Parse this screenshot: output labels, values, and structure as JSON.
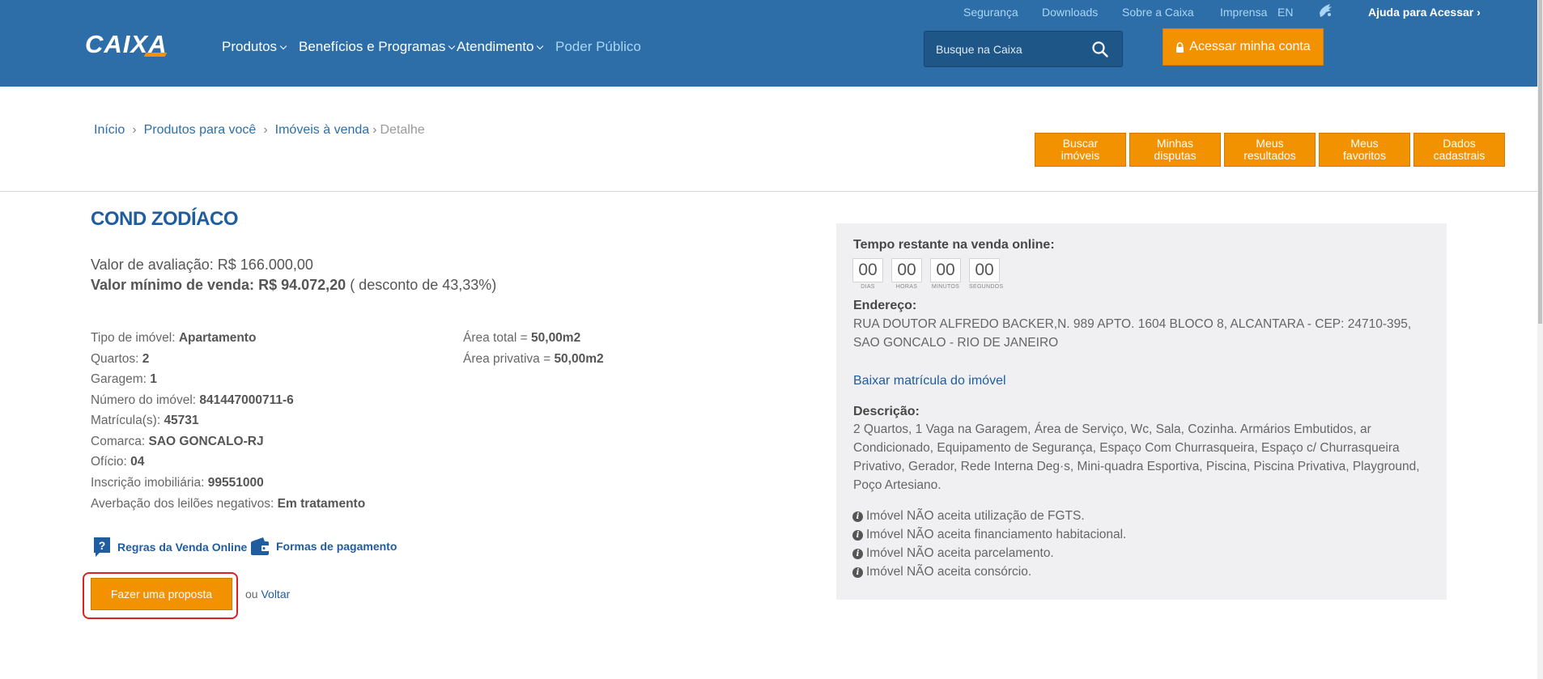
{
  "header": {
    "top_links": [
      "Segurança",
      "Downloads",
      "Sobre a Caixa",
      "Imprensa",
      "EN"
    ],
    "help_link": "Ajuda para Acessar ›",
    "logo_text": "CAIXA",
    "nav": [
      {
        "label": "Produtos",
        "dropdown": true
      },
      {
        "label": "Benefícios e Programas",
        "dropdown": true
      },
      {
        "label": "Atendimento",
        "dropdown": true
      },
      {
        "label": "Poder Público",
        "dropdown": false
      }
    ],
    "search_placeholder": "Busque na Caixa",
    "login_label": "Acessar minha conta"
  },
  "breadcrumb": {
    "items": [
      "Início",
      "Produtos para você",
      "Imóveis à venda"
    ],
    "current": "Detalhe",
    "separator": "›"
  },
  "actions": [
    {
      "line1": "Buscar",
      "line2": "imóveis"
    },
    {
      "line1": "Minhas",
      "line2": "disputas"
    },
    {
      "line1": "Meus",
      "line2": "resultados"
    },
    {
      "line1": "Meus",
      "line2": "favoritos"
    },
    {
      "line1": "Dados",
      "line2": "cadastrais"
    }
  ],
  "property": {
    "title": "COND ZODÍACO",
    "valor_avaliacao_label": "Valor de avaliação:",
    "valor_avaliacao": "R$ 166.000,00",
    "valor_minimo_label": "Valor mínimo de venda:",
    "valor_minimo": "R$ 94.072,20",
    "desconto": "( desconto de 43,33%)",
    "details": [
      {
        "label": "Tipo de imóvel:",
        "value": "Apartamento"
      },
      {
        "label": "Quartos:",
        "value": "2"
      },
      {
        "label": "Garagem:",
        "value": "1"
      },
      {
        "label": "Número do imóvel:",
        "value": "841447000711-6"
      },
      {
        "label": "Matrícula(s):",
        "value": "45731"
      },
      {
        "label": "Comarca:",
        "value": "SAO GONCALO-RJ"
      },
      {
        "label": "Ofício:",
        "value": "04"
      },
      {
        "label": "Inscrição imobiliária:",
        "value": "99551000"
      },
      {
        "label": "Averbação dos leilões negativos:",
        "value": "Em tratamento"
      }
    ],
    "areas": [
      {
        "label": "Área total =",
        "value": "50,00m2"
      },
      {
        "label": "Área privativa =",
        "value": "50,00m2"
      }
    ],
    "regras_link": "Regras da Venda Online",
    "pagamento_link": "Formas de pagamento",
    "proposal_button": "Fazer uma proposta",
    "ou": "ou",
    "voltar": "Voltar"
  },
  "panel": {
    "tempo_label": "Tempo restante na venda online:",
    "timer": [
      {
        "value": "00",
        "caption": "DIAS"
      },
      {
        "value": "00",
        "caption": "HORAS"
      },
      {
        "value": "00",
        "caption": "MINUTOS"
      },
      {
        "value": "00",
        "caption": "SEGUNDOS"
      }
    ],
    "endereco_label": "Endereço:",
    "endereco": "RUA DOUTOR ALFREDO BACKER,N. 989 APTO. 1604 BLOCO 8, ALCANTARA - CEP: 24710-395, SAO GONCALO - RIO DE JANEIRO",
    "matricula_link": "Baixar matrícula do imóvel",
    "descricao_label": "Descrição:",
    "descricao": "2 Quartos, 1 Vaga na Garagem, Área de Serviço, Wc, Sala, Cozinha. Armários Embutidos, ar Condicionado, Equipamento de Segurança, Espaço Com Churrasqueira, Espaço c/ Churrasqueira Privativo, Gerador, Rede Interna Deg·s, Mini-quadra Esportiva, Piscina, Piscina Privativa, Playground, Poço Artesiano.",
    "notes": [
      "Imóvel NÃO aceita utilização de FGTS.",
      "Imóvel NÃO aceita financiamento habitacional.",
      "Imóvel NÃO aceita parcelamento.",
      "Imóvel NÃO aceita consórcio."
    ]
  },
  "colors": {
    "header_blue": "#2d6ea9",
    "accent_orange": "#f39200",
    "title_blue": "#1f5da0",
    "highlight_red": "#e02020",
    "panel_bg": "#f0f0f2"
  }
}
